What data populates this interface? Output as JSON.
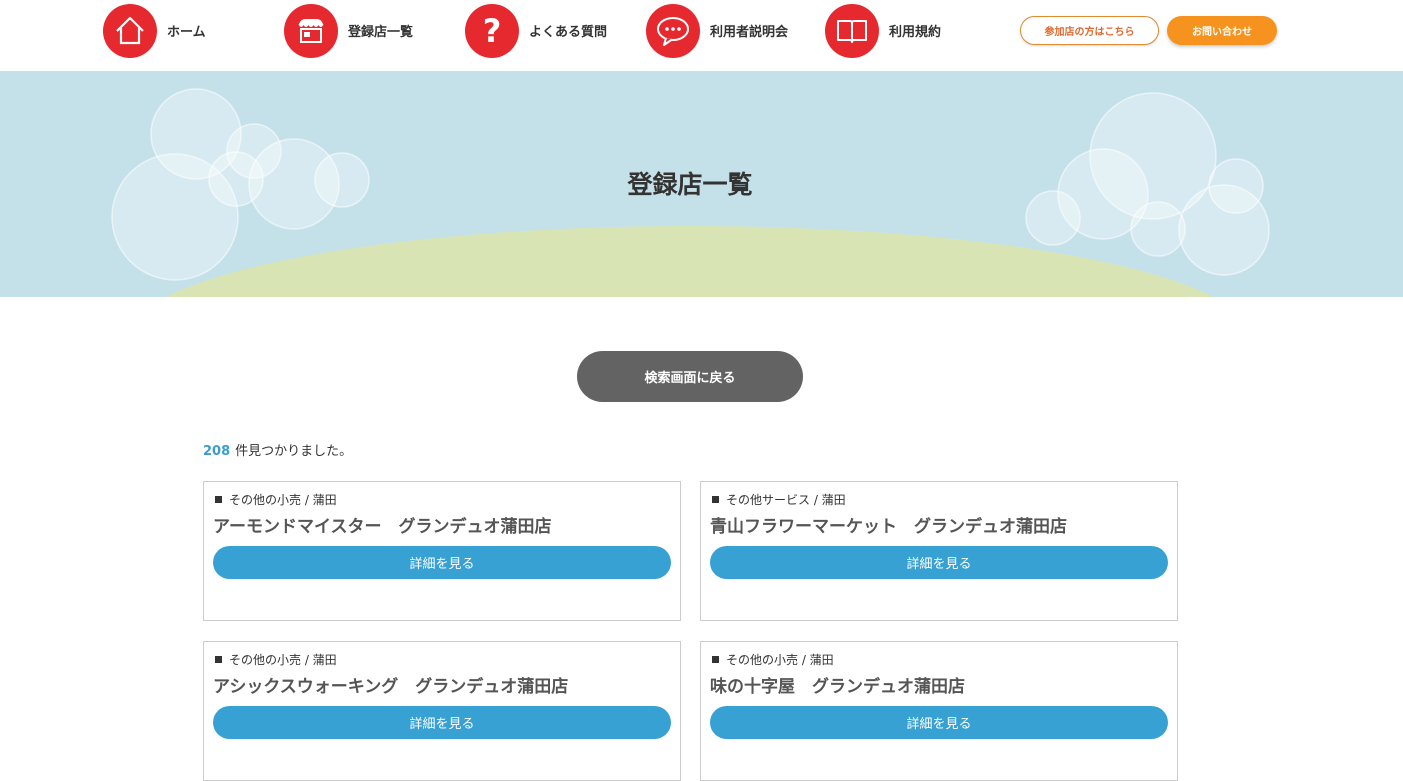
{
  "nav": [
    {
      "label": "ホーム",
      "icon": "home-icon"
    },
    {
      "label": "登録店一覧",
      "icon": "store-icon"
    },
    {
      "label": "よくある質問",
      "icon": "question-icon"
    },
    {
      "label": "利用者説明会",
      "icon": "chat-bubble-icon"
    },
    {
      "label": "利用規約",
      "icon": "book-icon"
    }
  ],
  "header_buttons": {
    "partner": "参加店の方はこちら",
    "contact": "お問い合わせ"
  },
  "hero": {
    "title": "登録店一覧"
  },
  "back_button": "検索画面に戻る",
  "results": {
    "count": "208",
    "suffix": "件見つかりました。"
  },
  "cards": [
    {
      "category": "その他の小売 / 蒲田",
      "name": "アーモンドマイスター　グランデュオ蒲田店",
      "button": "詳細を見る"
    },
    {
      "category": "その他サービス / 蒲田",
      "name": "青山フラワーマーケット　グランデュオ蒲田店",
      "button": "詳細を見る"
    },
    {
      "category": "その他の小売 / 蒲田",
      "name": "アシックスウォーキング　グランデュオ蒲田店",
      "button": "詳細を見る"
    },
    {
      "category": "その他の小売 / 蒲田",
      "name": "味の十字屋　グランデュオ蒲田店",
      "button": "詳細を見る"
    }
  ],
  "colors": {
    "nav_icon_red": "#e5292e",
    "contact_orange": "#f6931e",
    "hero_sky": "#c4e1ea",
    "hero_hill": "#d9e4b4",
    "detail_button_blue": "#37a1d4",
    "back_button_gray": "#636363",
    "count_blue": "#3b9ccf"
  }
}
